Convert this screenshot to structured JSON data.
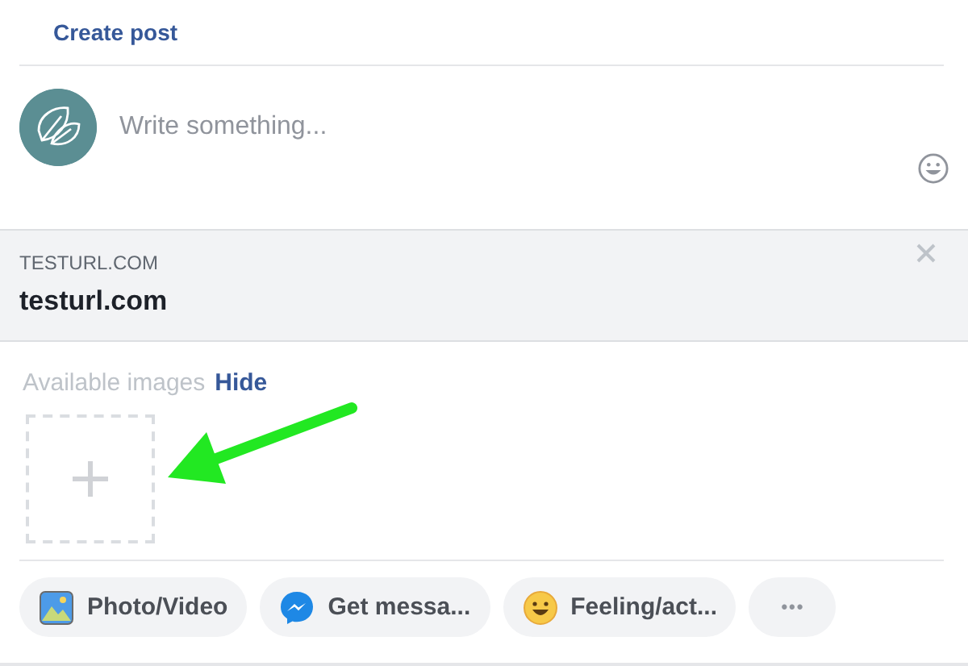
{
  "header": {
    "title": "Create post"
  },
  "composer": {
    "placeholder": "Write something..."
  },
  "link_preview": {
    "domain": "TESTURL.COM",
    "title": "testurl.com"
  },
  "images": {
    "label": "Available images",
    "action": "Hide"
  },
  "actions": [
    {
      "kind": "photo",
      "label": "Photo/Video"
    },
    {
      "kind": "messenger",
      "label": "Get messa..."
    },
    {
      "kind": "feeling",
      "label": "Feeling/act..."
    },
    {
      "kind": "more",
      "label": "•••"
    }
  ]
}
